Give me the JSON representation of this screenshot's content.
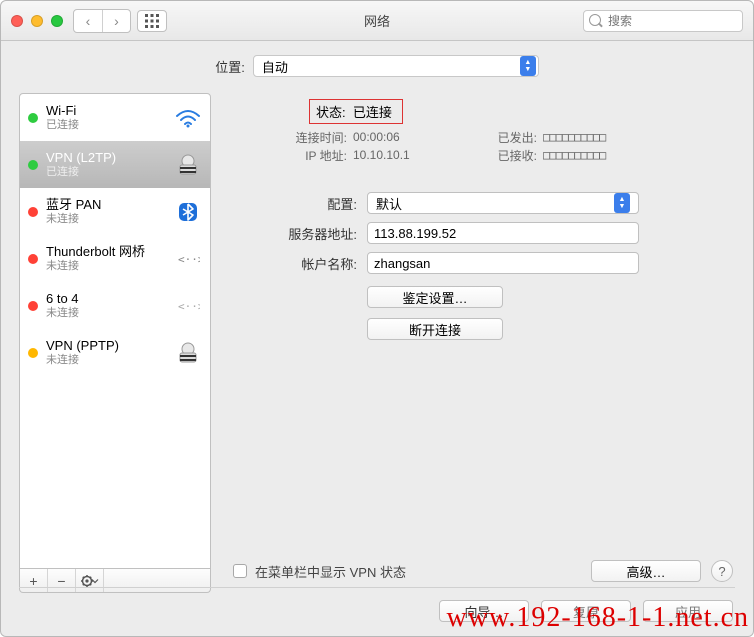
{
  "window": {
    "title": "网络"
  },
  "search": {
    "placeholder": "搜索"
  },
  "location": {
    "label": "位置:",
    "value": "自动"
  },
  "connections": [
    {
      "name": "Wi-Fi",
      "status": "已连接",
      "dot": "green",
      "icon": "wifi-icon",
      "selected": false
    },
    {
      "name": "VPN (L2TP)",
      "status": "已连接",
      "dot": "green",
      "icon": "lock-icon",
      "selected": true
    },
    {
      "name": "蓝牙 PAN",
      "status": "未连接",
      "dot": "red",
      "icon": "bluetooth-icon",
      "selected": false
    },
    {
      "name": "Thunderbolt 网桥",
      "status": "未连接",
      "dot": "red",
      "icon": "thunderbolt-icon",
      "selected": false
    },
    {
      "name": "6 to 4",
      "status": "未连接",
      "dot": "red",
      "icon": "sixtofour-icon",
      "selected": false
    },
    {
      "name": "VPN (PPTP)",
      "status": "未连接",
      "dot": "orange",
      "icon": "lock-icon",
      "selected": false
    }
  ],
  "detail": {
    "status_label": "状态:",
    "status_value": "已连接",
    "connect_time_label": "连接时间:",
    "connect_time_value": "00:00:06",
    "sent_label": "已发出:",
    "sent_value": "□□□□□□□□□□",
    "ip_label": "IP 地址:",
    "ip_value": "10.10.10.1",
    "recv_label": "已接收:",
    "recv_value": "□□□□□□□□□□",
    "config_label": "配置:",
    "config_value": "默认",
    "server_label": "服务器地址:",
    "server_value": "113.88.199.52",
    "account_label": "帐户名称:",
    "account_value": "zhangsan",
    "auth_button": "鉴定设置…",
    "disconnect_button": "断开连接",
    "menubar_checkbox": "在菜单栏中显示 VPN 状态",
    "advanced_button": "高级…"
  },
  "footer": {
    "assist": "向导…",
    "revert": "复原",
    "apply": "应用"
  },
  "watermark": "www.192-168-1-1.net.cn"
}
